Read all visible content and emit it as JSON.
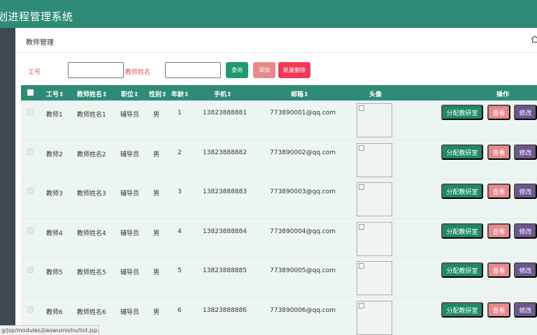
{
  "app": {
    "title": "划进程管理系统"
  },
  "page": {
    "title": "教师管理"
  },
  "search": {
    "id_label": "工号",
    "id_value": "",
    "name_label": "教师姓名",
    "name_value": "",
    "query_label": "查询",
    "add_label": "添加",
    "batch_delete_label": "批量删除"
  },
  "table": {
    "headers": {
      "id": "工号",
      "name": "教师姓名",
      "position": "职位",
      "gender": "性别",
      "age": "年龄",
      "phone": "手机",
      "email": "邮箱",
      "avatar": "头像",
      "actions": "操作"
    },
    "rows": [
      {
        "id": "教师1",
        "name": "教师姓名1",
        "position": "辅导员",
        "gender": "男",
        "age": "1",
        "phone": "13823888881",
        "email": "773890001@qq.com"
      },
      {
        "id": "教师2",
        "name": "教师姓名2",
        "position": "辅导员",
        "gender": "男",
        "age": "2",
        "phone": "13823888882",
        "email": "773890002@qq.com"
      },
      {
        "id": "教师3",
        "name": "教师姓名3",
        "position": "辅导员",
        "gender": "男",
        "age": "3",
        "phone": "13823888883",
        "email": "773890003@qq.com"
      },
      {
        "id": "教师4",
        "name": "教师姓名4",
        "position": "辅导员",
        "gender": "男",
        "age": "4",
        "phone": "13823888884",
        "email": "773890004@qq.com"
      },
      {
        "id": "教师5",
        "name": "教师姓名5",
        "position": "辅导员",
        "gender": "男",
        "age": "5",
        "phone": "13823888885",
        "email": "773890005@qq.com"
      },
      {
        "id": "教师6",
        "name": "教师姓名6",
        "position": "辅导员",
        "gender": "男",
        "age": "6",
        "phone": "13823888886",
        "email": "773890006@qq.com"
      }
    ],
    "actions": {
      "assign_label": "分配教研室",
      "view_label": "查看",
      "edit_label": "修改"
    }
  },
  "statusbar": {
    "url": "g/jsp/modules/jiaowumishu/list.jsp#"
  },
  "colors": {
    "header_green": "#2e8b76",
    "query_green": "#1e9a6e",
    "add_pink": "#e8888c",
    "delete_red": "#f03a55",
    "edit_purple": "#6c5790",
    "label_red": "#e0564d"
  },
  "icons": {
    "home": "home-icon",
    "sort": "sort-icon"
  }
}
